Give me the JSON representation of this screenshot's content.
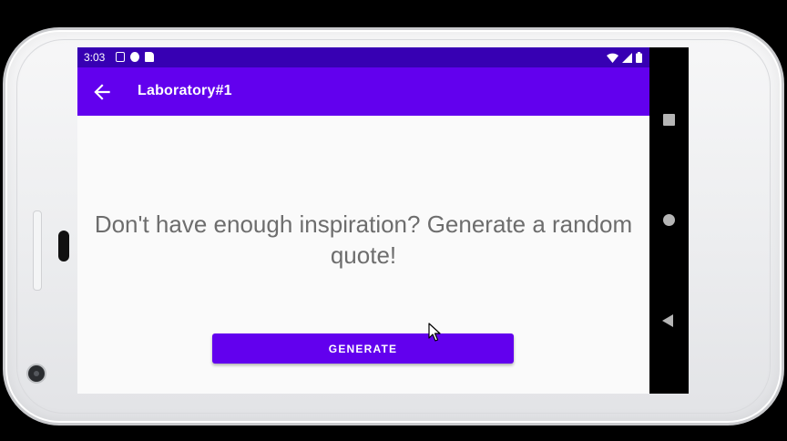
{
  "status_bar": {
    "time": "3:03",
    "left_icons": [
      "accessibility-icon",
      "sync-icon",
      "sd-card-icon"
    ],
    "right_icons": [
      "wifi-icon",
      "signal-icon",
      "battery-icon"
    ]
  },
  "app_bar": {
    "title": "Laboratory#1",
    "back_icon": "arrow-back-icon"
  },
  "main": {
    "quote_prompt": "Don't have enough inspiration? Generate a random quote!",
    "generate_label": "GENERATE"
  },
  "nav_bar": {
    "buttons": [
      "recent-apps-icon",
      "home-icon",
      "back-icon"
    ]
  },
  "colors": {
    "status_bar": "#3700b3",
    "primary": "#6200ee",
    "background": "#fafafa",
    "text_secondary": "#6d6d6d"
  }
}
